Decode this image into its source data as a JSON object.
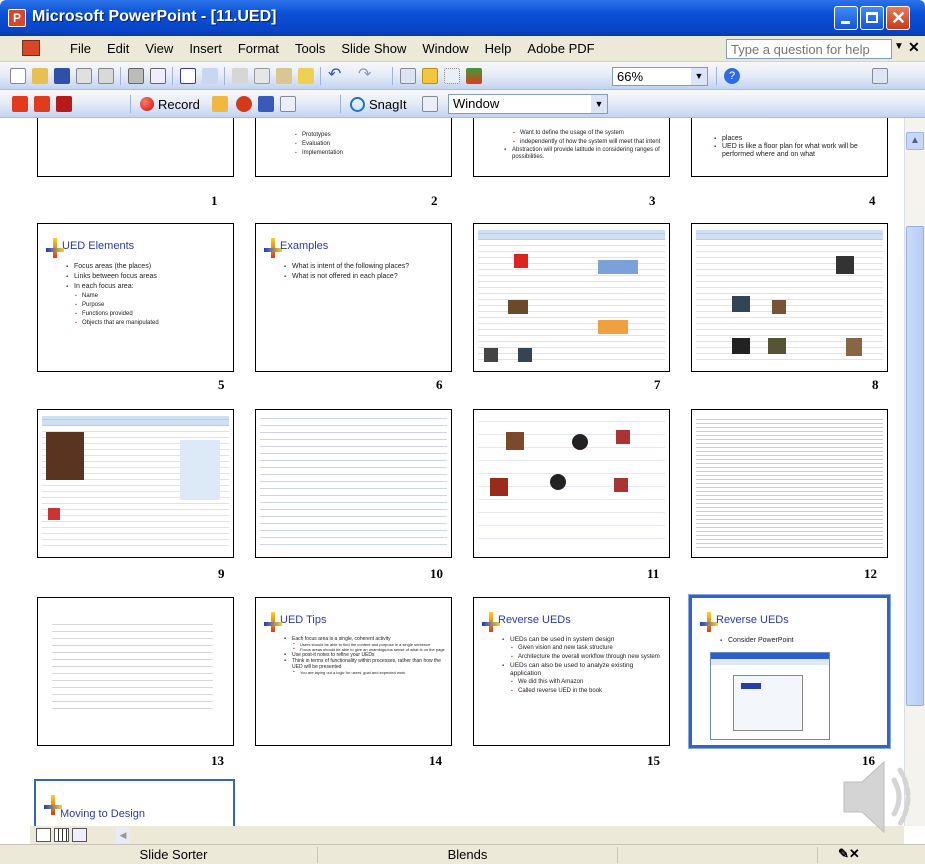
{
  "window": {
    "title": "Microsoft PowerPoint - [11.UED]"
  },
  "menu": {
    "items": [
      "File",
      "Edit",
      "View",
      "Insert",
      "Format",
      "Tools",
      "Slide Show",
      "Window",
      "Help",
      "Adobe PDF"
    ],
    "help_placeholder": "Type a question for help"
  },
  "toolbar": {
    "zoom": "66%",
    "record_label": "Record",
    "snagit_label": "SnagIt",
    "capture_mode": "Window"
  },
  "slides": [
    {
      "number": "1"
    },
    {
      "number": "2",
      "bullets": [
        "Prototypes",
        "Evaluation",
        "Implementation"
      ]
    },
    {
      "number": "3",
      "bullets": [
        "Want to define the usage of the system",
        "independently of how the system will meet that intent",
        "Abstraction will provide latitude in considering ranges of possibilities."
      ]
    },
    {
      "number": "4",
      "bullets": [
        "places",
        "UED is like a floor plan for what work will be performed where and on what"
      ]
    },
    {
      "number": "5",
      "title": "UED Elements",
      "bullets": [
        "Focus areas (the places)",
        "Links between focus areas",
        "In each focus area:"
      ],
      "sub_bullets": [
        "Name",
        "Purpose",
        "Functions provided",
        "Objects that are manipulated"
      ]
    },
    {
      "number": "6",
      "title": "Examples",
      "bullets": [
        "What is intent of the following places?",
        "What is not offered in each place?"
      ]
    },
    {
      "number": "7"
    },
    {
      "number": "8"
    },
    {
      "number": "9"
    },
    {
      "number": "10"
    },
    {
      "number": "11"
    },
    {
      "number": "12"
    },
    {
      "number": "13"
    },
    {
      "number": "14",
      "title": "UED Tips",
      "bullets": [
        "Each focus area is a single, coherent activity",
        "Use post-it notes to refine your UEDs",
        "Think in terms of functionality within processes, rather than how the UED will be presented"
      ],
      "sub_bullets": [
        "Users should be able to find the content and purpose in a single sentence",
        "Focus areas should be able to give an unambiguous sense of what is on the page",
        "You are laying out a logic for users' goal and expected work"
      ]
    },
    {
      "number": "15",
      "title": "Reverse UEDs",
      "bullets": [
        "UEDs can be used in system design",
        "UEDs can also be used to analyze existing application"
      ],
      "sub_bullets": [
        "Given vision and new task structure",
        "Architecture the overall workflow through new system",
        "We did this with Amazon",
        "Called reverse UED in the book"
      ]
    },
    {
      "number": "16",
      "title": "Reverse UEDs",
      "bullets": [
        "Consider PowerPoint"
      ]
    },
    {
      "number": "17",
      "title": "Moving to Design"
    }
  ],
  "status": {
    "view": "Slide Sorter",
    "design": "Blends"
  },
  "colors": {
    "titlebar": "#0a4fd6",
    "slide_title": "#2a3ab0",
    "selection": "#3264c8"
  }
}
